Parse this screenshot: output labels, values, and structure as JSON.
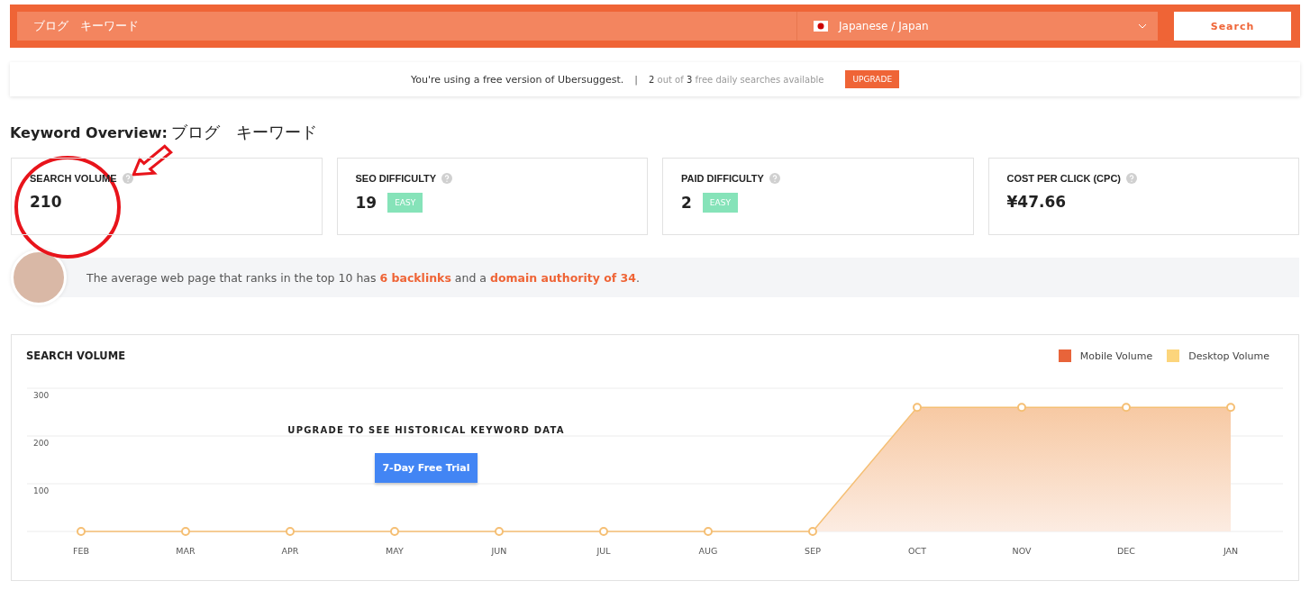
{
  "search_bar": {
    "keyword": "ブログ　キーワード",
    "language": "Japanese / Japan",
    "button": "Search"
  },
  "notice": {
    "text": "You're using a free version of Ubersuggest.",
    "separator": "|",
    "count_used": "2",
    "count_mid": " out of ",
    "count_total": "3",
    "count_tail": " free daily searches available",
    "button": "UPGRADE"
  },
  "overview": {
    "label": "Keyword Overview:",
    "keyword": "ブログ　キーワード"
  },
  "metrics": [
    {
      "label": "SEARCH VOLUME",
      "value": "210"
    },
    {
      "label": "SEO DIFFICULTY",
      "value": "19",
      "badge": "EASY"
    },
    {
      "label": "PAID DIFFICULTY",
      "value": "2",
      "badge": "EASY"
    },
    {
      "label": "COST PER CLICK (CPC)",
      "value": "¥47.66"
    }
  ],
  "tip": {
    "text": "The average web page that ranks in the top 10 has **6 backlinks** and a **domain authority of 34**."
  },
  "search_volume": {
    "title": "SEARCH VOLUME",
    "legend": [
      {
        "label": "Mobile Volume",
        "color": "#e8643a"
      },
      {
        "label": "Desktop Volume",
        "color": "#fcd57c"
      }
    ],
    "overlay_text": "UPGRADE TO SEE HISTORICAL KEYWORD DATA",
    "trial_button": "7-Day Free Trial",
    "chart_data": {
      "type": "area",
      "categories": [
        "FEB",
        "MAR",
        "APR",
        "MAY",
        "JUN",
        "JUL",
        "AUG",
        "SEP",
        "OCT",
        "NOV",
        "DEC",
        "JAN"
      ],
      "series": [
        {
          "color": "#f5bf74",
          "values": [
            0,
            0,
            0,
            0,
            0,
            0,
            0,
            0,
            260,
            260,
            260,
            260
          ]
        }
      ],
      "ylim": [
        0,
        300
      ],
      "yticks": [
        100,
        200,
        300
      ]
    }
  }
}
